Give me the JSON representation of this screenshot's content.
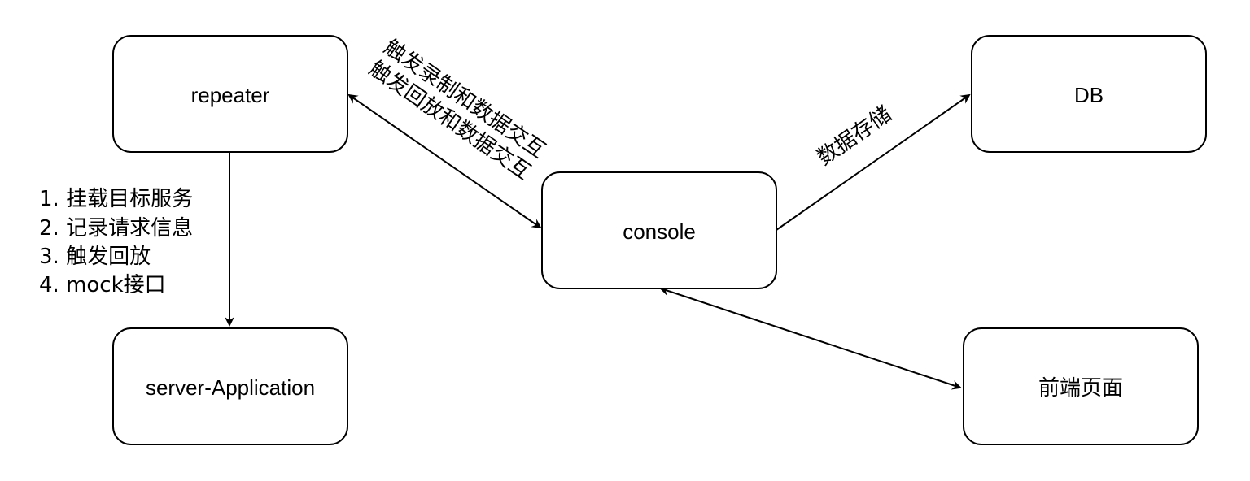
{
  "colors": {
    "stroke": "#000000",
    "background": "#ffffff",
    "node_fill": "#ffffff"
  },
  "nodes": {
    "repeater": "repeater",
    "server_application": "server-Application",
    "console": "console",
    "db": "DB",
    "frontend": "前端页面"
  },
  "edges": {
    "repeater_console": {
      "line1": "触发录制和数据交互",
      "line2": "触发回放和数据交互"
    },
    "repeater_server": {
      "items": [
        "1. 挂载目标服务",
        "2. 记录请求信息",
        "3. 触发回放",
        "4. mock接口"
      ]
    },
    "console_db": {
      "label": "数据存储"
    }
  }
}
